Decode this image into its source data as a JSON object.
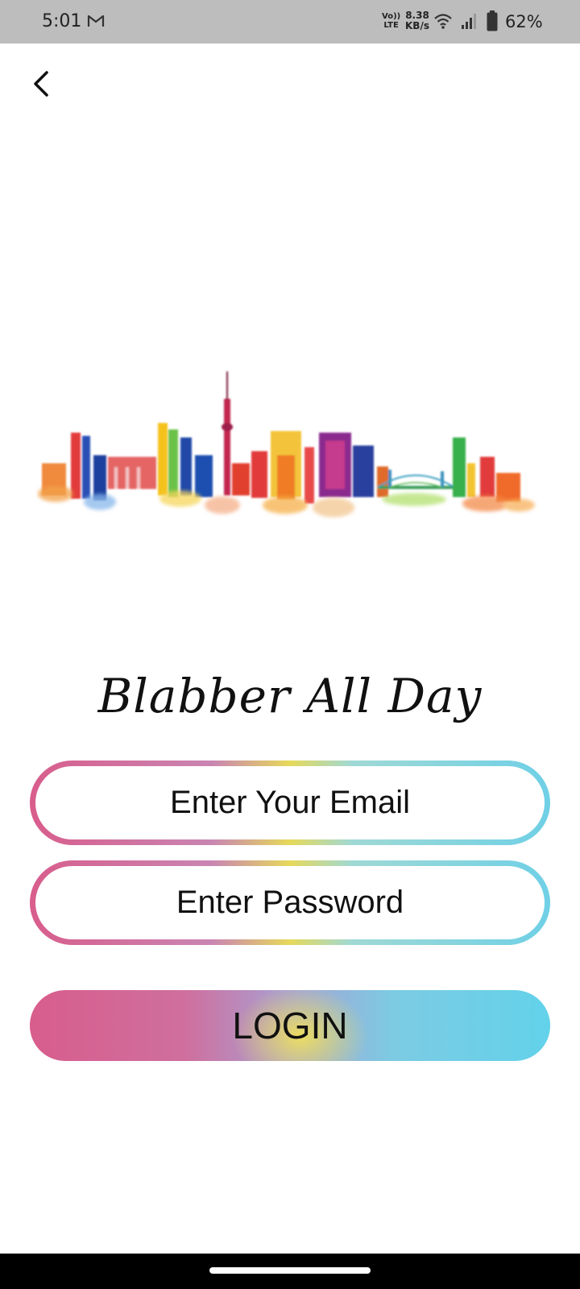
{
  "status_bar": {
    "time": "5:01",
    "volte_top": "Vo))",
    "volte_bottom": "LTE",
    "speed_value": "8.38",
    "speed_unit": "KB/s",
    "battery": "62%"
  },
  "app": {
    "title": "Blabber All Day"
  },
  "form": {
    "email_placeholder": "Enter Your Email",
    "email_value": "",
    "password_placeholder": "Enter Password",
    "password_value": "",
    "login_label": "LOGIN"
  },
  "icons": {
    "back": "back-arrow-icon",
    "gmail": "gmail-icon",
    "wifi": "wifi-icon",
    "signal": "signal-icon",
    "battery": "battery-icon"
  },
  "colors": {
    "gradient_start": "#d85d8c",
    "gradient_mid": "#e6d95a",
    "gradient_end": "#62d2ea"
  }
}
